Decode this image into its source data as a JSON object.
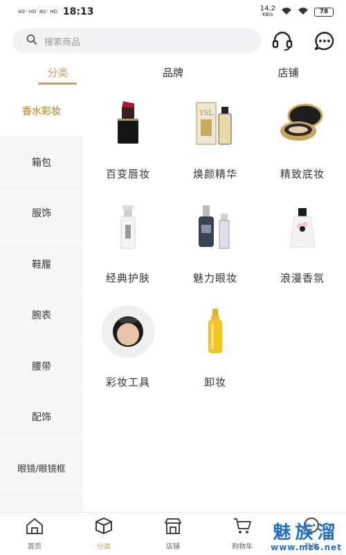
{
  "status_bar": {
    "signal1": "4G⁺ HD",
    "signal2": "4G⁺ HD",
    "time": "18:13",
    "speed": "14.2",
    "speed_unit": "KB/s",
    "battery": "78"
  },
  "search": {
    "placeholder": "搜索商品"
  },
  "top_tabs": [
    "分类",
    "品牌",
    "店铺"
  ],
  "sidebar": [
    "香水彩妆",
    "箱包",
    "服饰",
    "鞋履",
    "腕表",
    "腰带",
    "配饰",
    "眼镜/眼镜框"
  ],
  "grid": [
    {
      "label": "百变唇妆",
      "icon": "lipstick"
    },
    {
      "label": "焕颜精华",
      "icon": "serum-bottles"
    },
    {
      "label": "精致底妆",
      "icon": "cushion-compact"
    },
    {
      "label": "经典护肤",
      "icon": "skincare-tube"
    },
    {
      "label": "魅力眼妆",
      "icon": "eye-serum-bottles"
    },
    {
      "label": "浪漫香氛",
      "icon": "perfume-bottle"
    },
    {
      "label": "彩妆工具",
      "icon": "makeup-sponge"
    },
    {
      "label": "卸妆",
      "icon": "cleansing-oil"
    }
  ],
  "bottom_nav": [
    "首页",
    "分类",
    "店铺",
    "购物车",
    "我的"
  ],
  "watermark": {
    "main": "魅族溜",
    "sub": "www.mz6.net"
  },
  "colors": {
    "accent": "#c8a35a",
    "watermark": "#1f6fd1"
  }
}
